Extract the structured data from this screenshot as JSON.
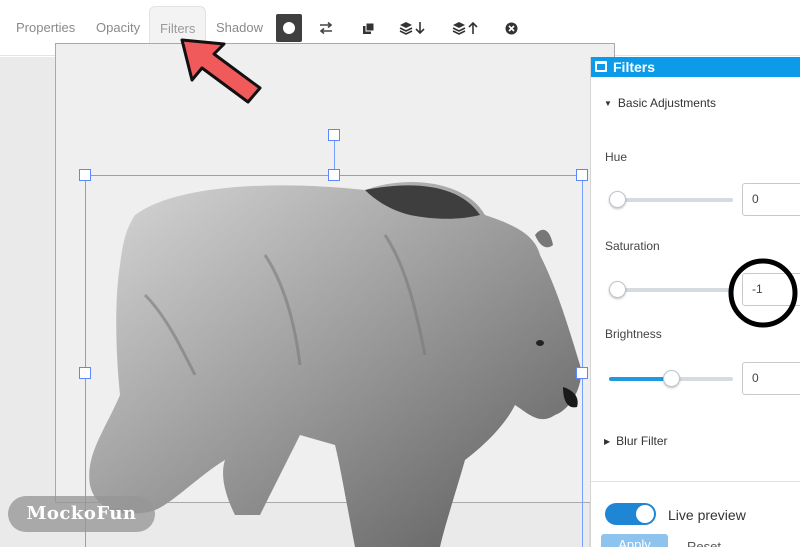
{
  "toolbar": {
    "tabs": [
      {
        "label": "Properties"
      },
      {
        "label": "Opacity"
      },
      {
        "label": "Filters"
      },
      {
        "label": "Shadow"
      }
    ],
    "tools": [
      "circle-fill-icon",
      "swap-arrows-icon",
      "duplicate-icon",
      "layer-down-icon",
      "layer-up-icon",
      "close-circle-icon"
    ]
  },
  "panel": {
    "title": "Filters",
    "basic_section": "Basic Adjustments",
    "hue": {
      "label": "Hue",
      "value": "0",
      "level": 0.0
    },
    "saturation": {
      "label": "Saturation",
      "value": "-1",
      "level": 0.0
    },
    "brightness": {
      "label": "Brightness",
      "value": "0",
      "level": 0.5
    },
    "blur_section": "Blur Filter",
    "live_preview": {
      "label": "Live preview",
      "on": true
    },
    "apply_label": "Apply",
    "reset_label": "Reset"
  },
  "watermark": "MockoFun",
  "colors": {
    "accent": "#0b9be8",
    "annotation_arrow": "#f05a5a",
    "annotation_circle": "#000000"
  }
}
